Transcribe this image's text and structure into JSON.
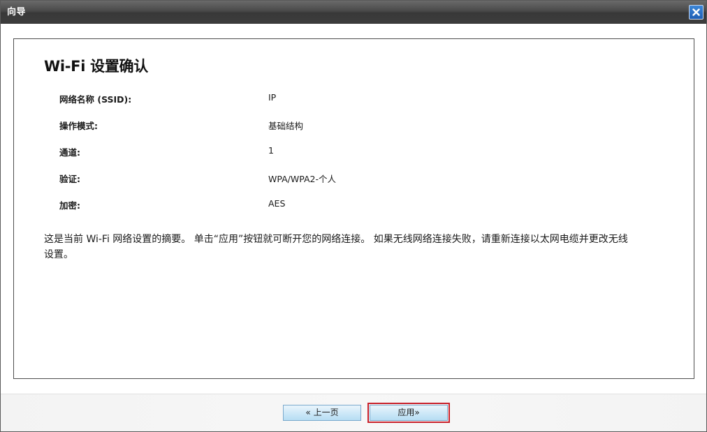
{
  "window": {
    "title": "向导",
    "close_label": "×"
  },
  "panel": {
    "heading": "Wi-Fi 设置确认",
    "rows": [
      {
        "label": "网络名称 (SSID):",
        "value": "IP"
      },
      {
        "label": "操作模式:",
        "value": "基础结构"
      },
      {
        "label": "通道:",
        "value": "1"
      },
      {
        "label": "验证:",
        "value": "WPA/WPA2-个人"
      },
      {
        "label": "加密:",
        "value": "AES"
      }
    ],
    "summary": "这是当前 Wi-Fi 网络设置的摘要。 单击“应用”按钮就可断开您的网络连接。 如果无线网络连接失败，请重新连接以太网电缆并更改无线设置。"
  },
  "footer": {
    "prev_label": "« 上一页",
    "apply_label": "应用»"
  }
}
